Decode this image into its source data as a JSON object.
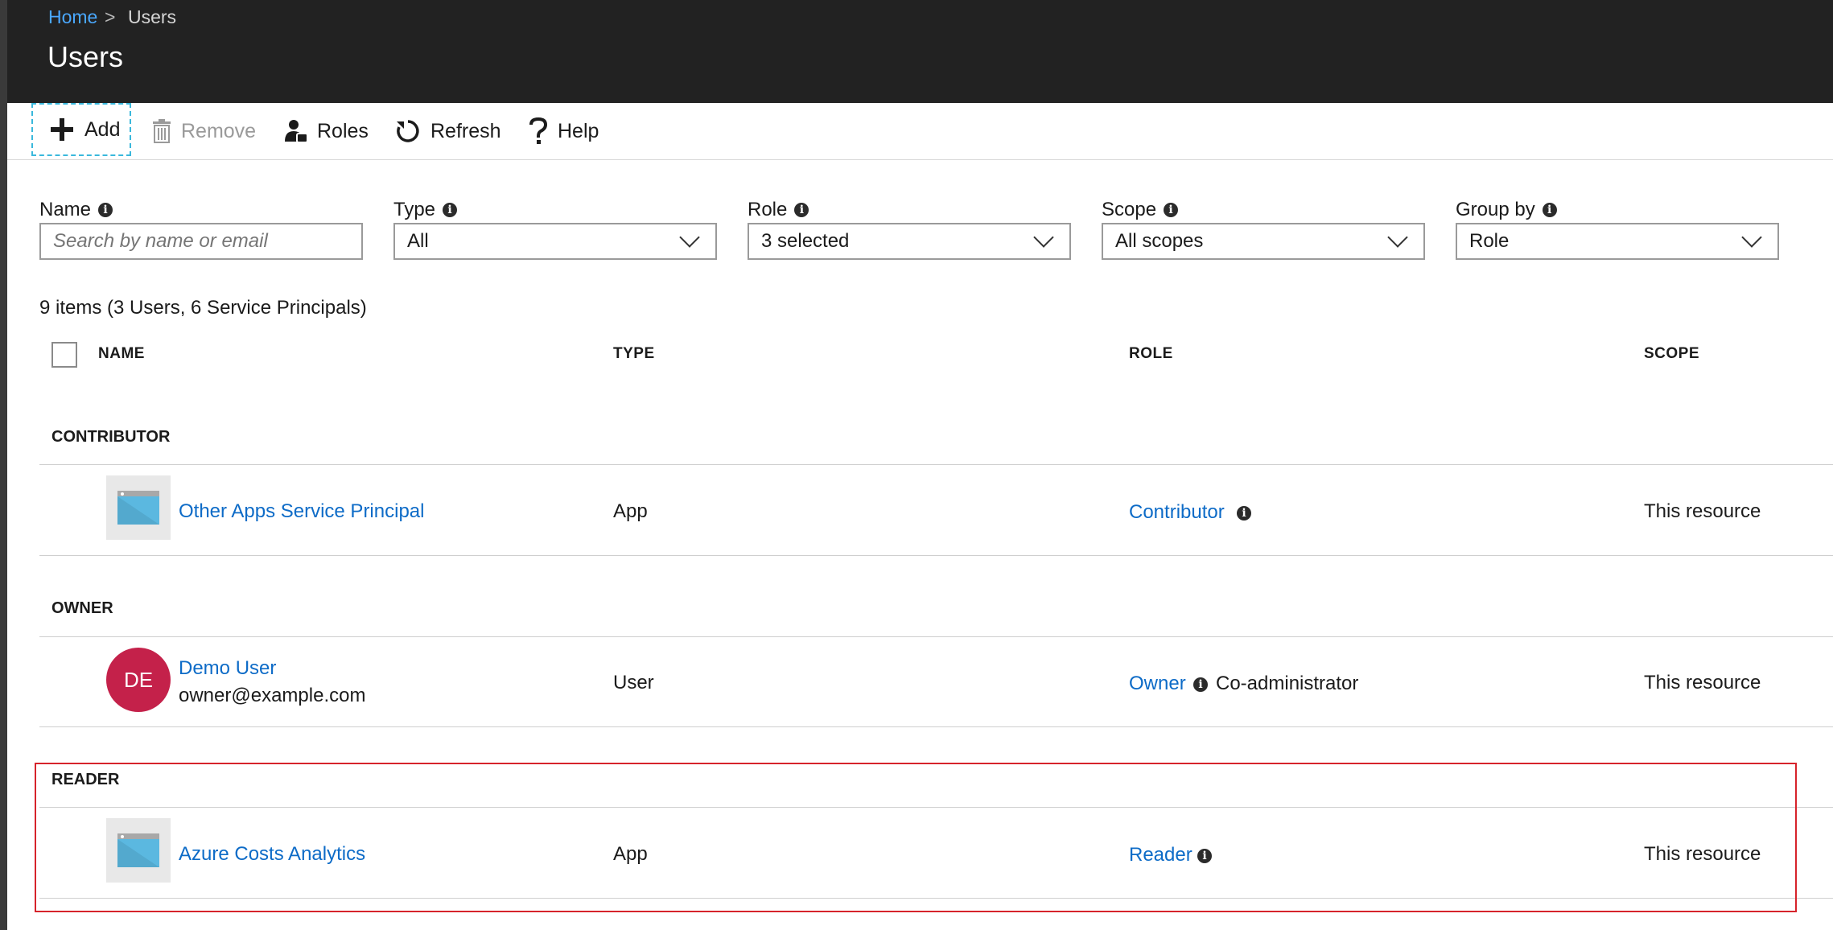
{
  "breadcrumb": {
    "home": "Home",
    "separator": ">",
    "current": "Users"
  },
  "page_title": "Users",
  "toolbar": {
    "add": "Add",
    "remove": "Remove",
    "roles": "Roles",
    "refresh": "Refresh",
    "help": "Help"
  },
  "filters": {
    "name": {
      "label": "Name",
      "placeholder": "Search by name or email"
    },
    "type": {
      "label": "Type",
      "value": "All"
    },
    "role": {
      "label": "Role",
      "value": "3 selected"
    },
    "scope": {
      "label": "Scope",
      "value": "All scopes"
    },
    "group_by": {
      "label": "Group by",
      "value": "Role"
    }
  },
  "summary": "9 items (3 Users, 6 Service Principals)",
  "columns": {
    "name": "NAME",
    "type": "TYPE",
    "role": "ROLE",
    "scope": "SCOPE"
  },
  "groups": [
    {
      "title": "CONTRIBUTOR",
      "rows": [
        {
          "icon": "app-icon",
          "name": "Other Apps Service Principal",
          "type": "App",
          "role": "Contributor",
          "role_extra": "",
          "scope": "This resource"
        }
      ]
    },
    {
      "title": "OWNER",
      "rows": [
        {
          "icon": "avatar",
          "initials": "DE",
          "name": "Demo User",
          "email": "owner@example.com",
          "type": "User",
          "role": "Owner",
          "role_extra": "Co-administrator",
          "scope": "This resource"
        }
      ]
    },
    {
      "title": "READER",
      "rows": [
        {
          "icon": "app-icon",
          "name": "Azure Costs Analytics",
          "type": "App",
          "role": "Reader",
          "role_extra": "",
          "scope": "This resource"
        }
      ]
    }
  ],
  "info_glyph": "i",
  "colors": {
    "link": "#0d6bc7",
    "header_bg": "#222222",
    "avatar": "#c4214a",
    "highlight": "#d6232b",
    "focus_dash": "#3ab8dc"
  }
}
